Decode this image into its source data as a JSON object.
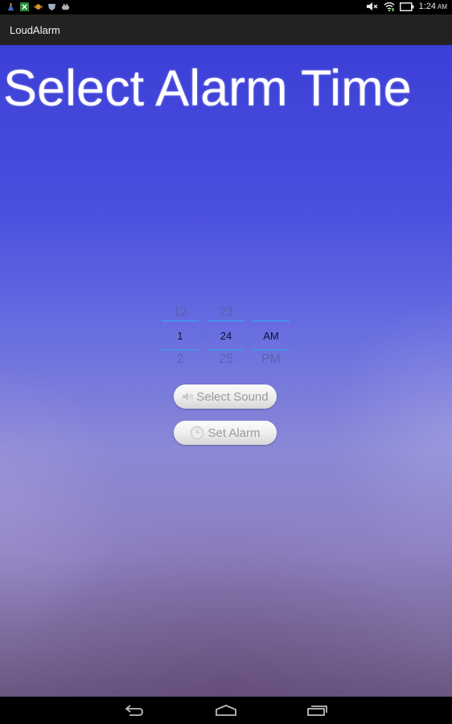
{
  "status_bar": {
    "left_icons": [
      "cleaner-icon",
      "excel-icon",
      "planet-icon",
      "shield-icon",
      "gamepad-icon"
    ],
    "right_icons": [
      "volume-muted-icon",
      "wifi-icon",
      "battery-icon"
    ],
    "time": "1:24",
    "ampm": "AM"
  },
  "action_bar": {
    "title": "LoudAlarm"
  },
  "main": {
    "headline": "Select Alarm Time",
    "time_picker": {
      "hour": {
        "prev": "12",
        "current": "1",
        "next": "2"
      },
      "separator": ":",
      "minute": {
        "prev": "23",
        "current": "24",
        "next": "25"
      },
      "period": {
        "prev": "",
        "current": "AM",
        "next": "PM"
      }
    },
    "buttons": {
      "select_sound": "Select Sound",
      "set_alarm": "Set Alarm"
    }
  },
  "nav_bar": {
    "buttons": [
      "back",
      "home",
      "recent-apps"
    ]
  },
  "colors": {
    "accent_line": "#4a8fe8",
    "background_top": "#3c3fd6",
    "background_bottom": "#6a5680"
  }
}
